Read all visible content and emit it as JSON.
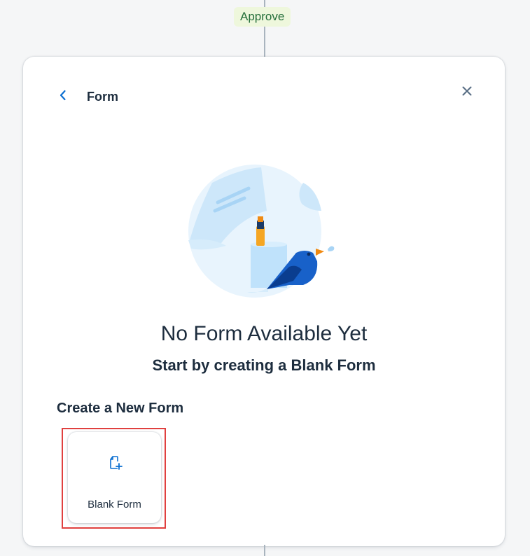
{
  "flow": {
    "approve_label": "Approve"
  },
  "panel": {
    "title": "Form",
    "back_icon": "chevron-left-icon",
    "close_icon": "close-icon"
  },
  "empty_state": {
    "illustration": "bird-with-highlighter-illustration",
    "title": "No Form Available Yet",
    "subtitle": "Start by creating a Blank Form"
  },
  "create_section": {
    "heading": "Create a New Form",
    "tiles": [
      {
        "label": "Blank Form",
        "icon": "add-document-icon"
      }
    ]
  },
  "colors": {
    "accent": "#0a6ed1",
    "text": "#1d2d3e",
    "approve_bg": "#eef7dc",
    "approve_text": "#256f3a",
    "highlight": "#e0403f"
  }
}
